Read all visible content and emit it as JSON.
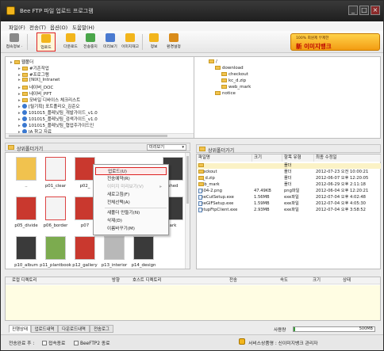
{
  "window": {
    "title": "Bee FTP 파일 업로드 프로그램",
    "min_label": "_",
    "max_label": "□",
    "close_label": "×"
  },
  "menu": [
    "파일(F)",
    "전송(T)",
    "옵션(O)",
    "도움말(H)"
  ],
  "toolbar": {
    "buttons": [
      {
        "label": "접속정보 ·",
        "color": "#8a8a8a"
      },
      {
        "label": "업로드",
        "color": "#f2b51c"
      },
      {
        "label": "다운로드",
        "color": "#f2b51c"
      },
      {
        "label": "전송중지",
        "color": "#4aa64a"
      },
      {
        "label": "미리보기",
        "color": "#4a7ad0"
      },
      {
        "label": "이미지재고",
        "color": "#f2b51c"
      },
      {
        "label": "정보",
        "color": "#f2b51c"
      },
      {
        "label": "환경설정",
        "color": "#d98c1a"
      }
    ],
    "banner_small": "100% 회원제 무제한",
    "banner_big": "新 이미지뱅크"
  },
  "local_tree": [
    {
      "label": "웹폴더",
      "type": "folder",
      "level": 0
    },
    {
      "label": "#기존작업",
      "type": "folder",
      "level": 1
    },
    {
      "label": "#프로그램",
      "type": "folder",
      "level": 1
    },
    {
      "label": "[NIX]_Intranet",
      "type": "folder",
      "level": 1
    },
    {
      "label": "네이버_DOC",
      "type": "folder",
      "level": 1
    },
    {
      "label": "네이버_PPT",
      "type": "folder",
      "level": 1
    },
    {
      "label": "모바일 디바이스 체크리스트",
      "type": "folder",
      "level": 1
    },
    {
      "label": "[릴기획] 포트폴리오_김준오",
      "type": "ie",
      "level": 1
    },
    {
      "label": "101015_플레닛팀_개발가이드_v1.0",
      "type": "ie",
      "level": 1
    },
    {
      "label": "101015_플레닛팀_검색가이드_v1.0",
      "type": "ie",
      "level": 1
    },
    {
      "label": "101015_플레닛팀_협업주가이드인",
      "type": "ie",
      "level": 1
    },
    {
      "label": "IA 참고 자료",
      "type": "ie",
      "level": 1
    }
  ],
  "remote_tree": [
    {
      "label": "/",
      "level": 0
    },
    {
      "label": "download",
      "level": 1
    },
    {
      "label": "checkout",
      "level": 2
    },
    {
      "label": "kc_d.zip",
      "level": 2
    },
    {
      "label": "web_mark",
      "level": 2
    },
    {
      "label": "notice",
      "level": 1
    }
  ],
  "local_header": {
    "title": "상위폴더가기",
    "view": "미리보기"
  },
  "remote_header": {
    "title": "상위폴더가기"
  },
  "thumbnails": [
    {
      "caption": "..",
      "kind": "folder"
    },
    {
      "caption": "p01_clear",
      "kind": "ppt"
    },
    {
      "caption": "p02_",
      "kind": "red"
    },
    {
      "caption": "",
      "kind": "hidden"
    },
    {
      "caption": "",
      "kind": "hidden"
    },
    {
      "caption": "shed",
      "kind": "dark"
    },
    {
      "caption": "p05_divide",
      "kind": "red"
    },
    {
      "caption": "p06_border",
      "kind": "ppt"
    },
    {
      "caption": "p07",
      "kind": "red"
    },
    {
      "caption": "",
      "kind": "hidden"
    },
    {
      "caption": "",
      "kind": "hidden"
    },
    {
      "caption": "ark",
      "kind": "dark"
    },
    {
      "caption": "p10_album",
      "kind": "dark"
    },
    {
      "caption": "p11_plantbook",
      "kind": "green"
    },
    {
      "caption": "p12_gallery",
      "kind": "red"
    },
    {
      "caption": "p13_interior",
      "kind": "gray"
    },
    {
      "caption": "p14_design",
      "kind": "dark"
    }
  ],
  "context_menu": [
    {
      "label": "업로드(U)",
      "state": "highlight"
    },
    {
      "label": "전송예약(R)",
      "state": "normal"
    },
    {
      "label": "이미지 미리보기(V)",
      "state": "disabled",
      "arrow": "▸"
    },
    {
      "label": "새로고침(F)",
      "state": "normal"
    },
    {
      "label": "전체선택(A)",
      "state": "normal"
    },
    {
      "label": "새폴더 만들기(N)",
      "state": "normal"
    },
    {
      "label": "삭제(D)",
      "state": "normal"
    },
    {
      "label": "이름바꾸기(M)",
      "state": "normal"
    }
  ],
  "remote_list": {
    "columns": [
      "파일명",
      "크기",
      "항목 유형",
      "최종 수정일"
    ],
    "rows": [
      {
        "name": "..",
        "size": "",
        "type": "폴더",
        "date": "",
        "icon": "folder"
      },
      {
        "name": "checkout",
        "size": "",
        "type": "폴더",
        "date": "2012-07-23 오전 10:00:21",
        "icon": "folder"
      },
      {
        "name": "kc_d.zip",
        "size": "",
        "type": "폴더",
        "date": "2012-06-07 오후 12:20:05",
        "icon": "folder"
      },
      {
        "name": "web_mark",
        "size": "",
        "type": "폴더",
        "date": "2012-06-29 오후 2:11:18",
        "icon": "folder"
      },
      {
        "name": "0604-2.png",
        "size": "47.49KB",
        "type": "png파일",
        "date": "2012-06-04 오후 12:20:21",
        "icon": "file"
      },
      {
        "name": "BeeCutSetup.exe",
        "size": "1.56MB",
        "type": "exe파일",
        "date": "2012-07-04 오후 4:02:48",
        "icon": "file"
      },
      {
        "name": "BeeGIFSetup.exe",
        "size": "1.59MB",
        "type": "exe파일",
        "date": "2012-07-04 오후 4:05:30",
        "icon": "file"
      },
      {
        "name": "SetupFtpClient.exe",
        "size": "2.93MB",
        "type": "exe파일",
        "date": "2012-07-04 오후 3:58:52",
        "icon": "file"
      }
    ]
  },
  "queue": {
    "columns": [
      "로컬 디렉토리",
      "방향",
      "호스트 디렉토리",
      "전송",
      "속도",
      "크기",
      "상태"
    ]
  },
  "tabs": [
    "진행상태",
    "업로드내역",
    "다운로드내역",
    "전송로그"
  ],
  "usage": {
    "label": "사용량",
    "value": "500MB",
    "fraction": 0.02
  },
  "status": {
    "after_transfer_label": "전송완료 후 :",
    "checks": [
      "접속종료",
      "BeeFTP2 종료"
    ],
    "server": "서비스상품명 : 신이미지뱅크 관리자"
  }
}
